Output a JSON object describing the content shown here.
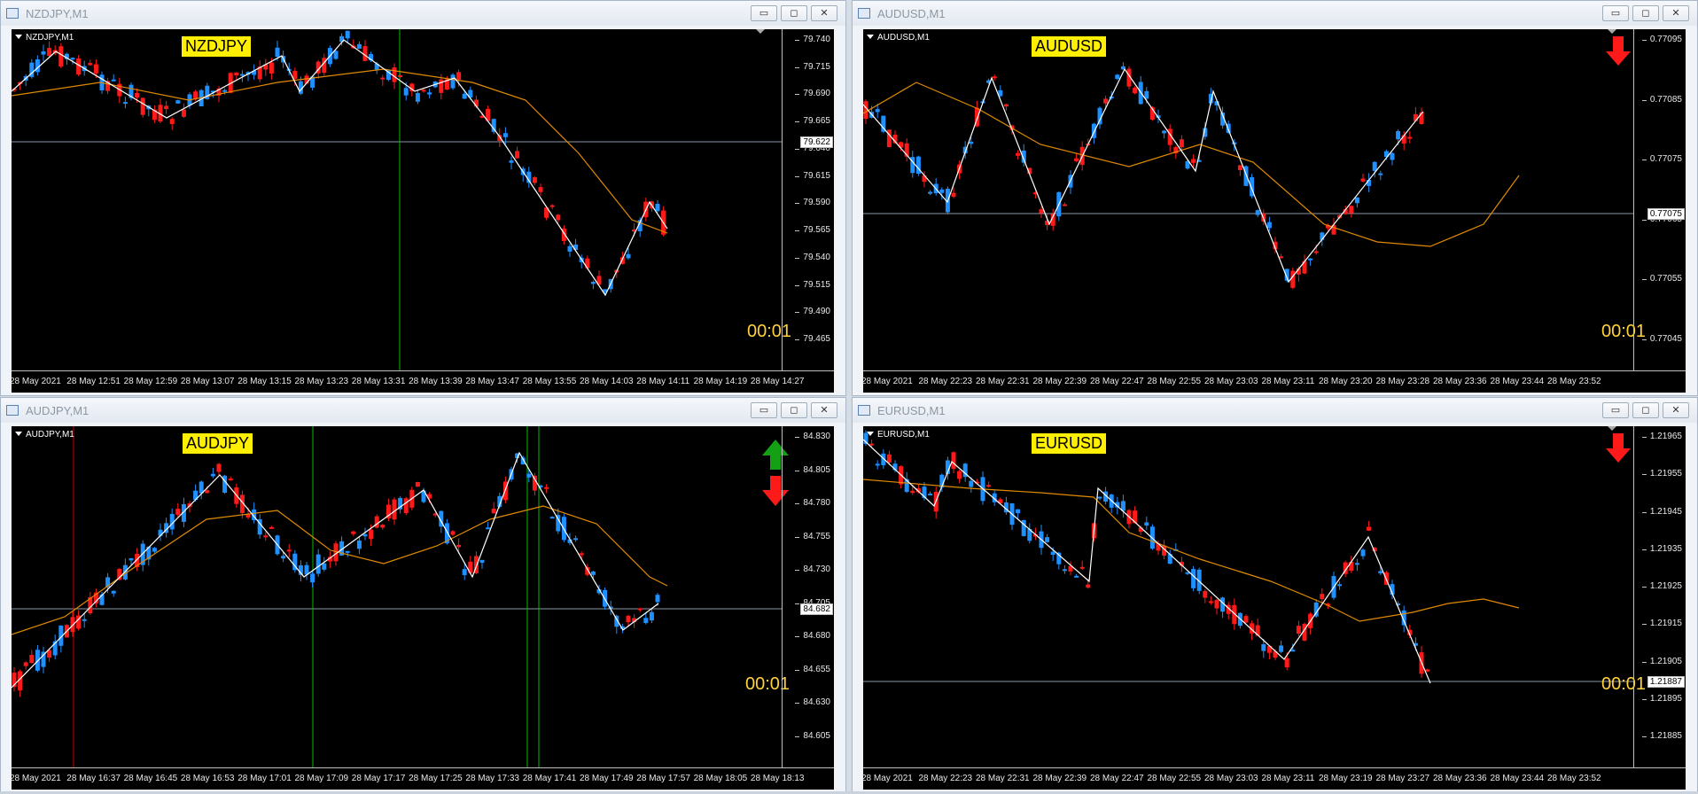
{
  "windows": [
    {
      "id": "nzdjpy",
      "title": "NZDJPY,M1",
      "header": "NZDJPY,M1",
      "label": "NZDJPY",
      "timer": "00:01",
      "price_ticks": [
        "79.740",
        "79.715",
        "79.690",
        "79.665",
        "79.640",
        "79.615",
        "79.590",
        "79.565",
        "79.540",
        "79.515",
        "79.490",
        "79.465"
      ],
      "current_price": "79.622",
      "time_labels": [
        "28 May 2021",
        "28 May 12:51",
        "28 May 12:59",
        "28 May 13:07",
        "28 May 13:15",
        "28 May 13:23",
        "28 May 13:31",
        "28 May 13:39",
        "28 May 13:47",
        "28 May 13:55",
        "28 May 14:03",
        "28 May 14:11",
        "28 May 14:19",
        "28 May 14:27"
      ],
      "signal_arrows": []
    },
    {
      "id": "audusd",
      "title": "AUDUSD,M1",
      "header": "AUDUSD,M1",
      "label": "AUDUSD",
      "timer": "00:01",
      "price_ticks": [
        "0.77095",
        "0.77085",
        "0.77075",
        "0.77065",
        "0.77055",
        "0.77045"
      ],
      "current_price": "0.77075",
      "time_labels": [
        "28 May 2021",
        "28 May 22:23",
        "28 May 22:31",
        "28 May 22:39",
        "28 May 22:47",
        "28 May 22:55",
        "28 May 23:03",
        "28 May 23:11",
        "28 May 23:20",
        "28 May 23:28",
        "28 May 23:36",
        "28 May 23:44",
        "28 May 23:52"
      ],
      "signal_arrows": [
        "down"
      ]
    },
    {
      "id": "audjpy",
      "title": "AUDJPY,M1",
      "header": "AUDJPY,M1",
      "label": "AUDJPY",
      "timer": "00:01",
      "price_ticks": [
        "84.830",
        "84.805",
        "84.780",
        "84.755",
        "84.730",
        "84.705",
        "84.680",
        "84.655",
        "84.630",
        "84.605"
      ],
      "current_price": "84.682",
      "time_labels": [
        "28 May 2021",
        "28 May 16:37",
        "28 May 16:45",
        "28 May 16:53",
        "28 May 17:01",
        "28 May 17:09",
        "28 May 17:17",
        "28 May 17:25",
        "28 May 17:33",
        "28 May 17:41",
        "28 May 17:49",
        "28 May 17:57",
        "28 May 18:05",
        "28 May 18:13"
      ],
      "signal_arrows": [
        "up",
        "down"
      ]
    },
    {
      "id": "eurusd",
      "title": "EURUSD,M1",
      "header": "EURUSD,M1",
      "label": "EURUSD",
      "timer": "00:01",
      "price_ticks": [
        "1.21965",
        "1.21955",
        "1.21945",
        "1.21935",
        "1.21925",
        "1.21915",
        "1.21905",
        "1.21895",
        "1.21885"
      ],
      "current_price": "1.21887",
      "time_labels": [
        "28 May 2021",
        "28 May 22:23",
        "28 May 22:31",
        "28 May 22:39",
        "28 May 22:47",
        "28 May 22:55",
        "28 May 23:03",
        "28 May 23:11",
        "28 May 23:19",
        "28 May 23:27",
        "28 May 23:36",
        "28 May 23:44",
        "28 May 23:52"
      ],
      "signal_arrows": [
        "down"
      ]
    }
  ],
  "window_buttons": {
    "minimize": "▭",
    "maximize": "◻",
    "close": "✕"
  },
  "colors": {
    "bull": "#1e90ff",
    "bear": "#ff1a1a",
    "ma": "#e08a00",
    "zigzag": "#ffffff",
    "vline_green": "#00c000",
    "vline_red": "#d00000",
    "label_bg": "#ffef00",
    "timer": "#ffd23a"
  }
}
